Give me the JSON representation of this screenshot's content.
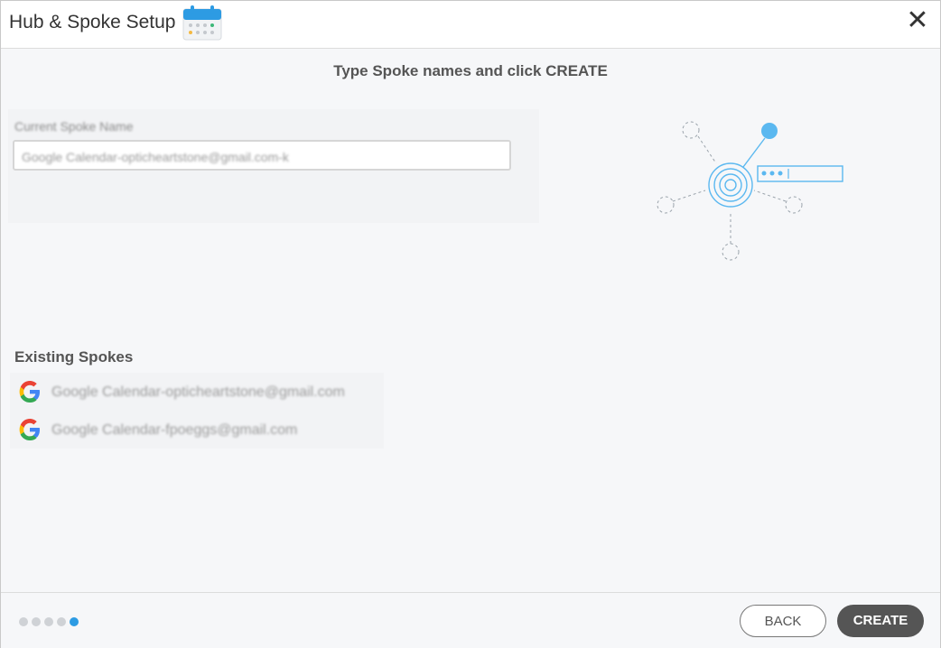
{
  "header": {
    "title": "Hub & Spoke Setup",
    "close_glyph": "✕",
    "icon": "calendar-icon"
  },
  "instruction": "Type Spoke names and click CREATE",
  "form": {
    "label": "Current Spoke Name",
    "value": "Google Calendar-opticheartstone@gmail.com-k"
  },
  "existing": {
    "title": "Existing Spokes",
    "items": [
      {
        "icon": "google-icon",
        "name": "Google Calendar-opticheartstone@gmail.com"
      },
      {
        "icon": "google-icon",
        "name": "Google Calendar-fpoeggs@gmail.com"
      }
    ]
  },
  "footer": {
    "steps_total": 5,
    "active_step": 5,
    "back_label": "BACK",
    "create_label": "CREATE"
  },
  "colors": {
    "accent": "#2d9be3",
    "illustration": "#5bb8f0",
    "create_button": "#555555"
  }
}
